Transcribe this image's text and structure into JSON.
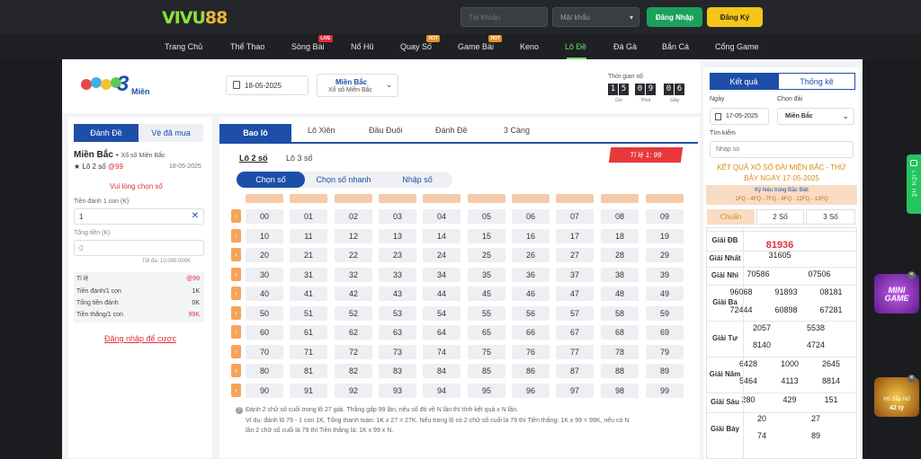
{
  "header": {
    "logo_a": "VIVU",
    "logo_b": "88",
    "username_placeholder": "Tài khoản",
    "password_placeholder": "Mật khẩu",
    "login_label": "Đăng Nhập",
    "register_label": "Đăng Ký",
    "colors": {
      "login": "#1aa15a",
      "register": "#f5c518"
    }
  },
  "nav": {
    "items": [
      {
        "label": "Trang Chủ"
      },
      {
        "label": "Thể Thao"
      },
      {
        "label": "Sòng Bài",
        "badge": "LIVE"
      },
      {
        "label": "Nổ Hũ"
      },
      {
        "label": "Quay Số",
        "badge": "HOT"
      },
      {
        "label": "Game Bài",
        "badge": "HOT"
      },
      {
        "label": "Keno"
      },
      {
        "label": "Lô Đề"
      },
      {
        "label": "Đá Gà"
      },
      {
        "label": "Bắn Cá"
      },
      {
        "label": "Cổng Game"
      }
    ]
  },
  "topbar": {
    "logo_text": "Miền",
    "logo_number": "3",
    "date": "18-05-2025",
    "region_title": "Miền Bắc",
    "region_sub": "Xổ số Miền Bắc",
    "time_label": "Thời gian xổ",
    "digits": [
      "1",
      "5",
      "0",
      "9",
      "0",
      "6"
    ],
    "units": [
      "Giờ",
      "Phút",
      "Giây"
    ]
  },
  "left": {
    "tabs": [
      "Đánh Đề",
      "Vé đã mua"
    ],
    "region": "Miền Bắc -",
    "region_sub": "Xổ số Miền Bắc",
    "bet_type": "★ Lô 2 số",
    "bet_rate": "@99",
    "date": "18-05-2025",
    "choose_prompt": "Vui lòng chọn số",
    "per_unit_label": "Tiền đánh 1 con (K)",
    "per_unit_value": "1",
    "total_label": "Tổng tiền (K)",
    "total_placeholder": "0",
    "max_text": "Tối đa: 10.000.000K",
    "rows": [
      {
        "label": "Tỉ lệ",
        "value": "@99"
      },
      {
        "label": "Tiền đánh/1 con",
        "value": "1K"
      },
      {
        "label": "Tổng tiền đánh",
        "value": "0K"
      },
      {
        "label": "Tiền thắng/1 con",
        "value": "99K"
      }
    ],
    "login_link": "Đăng nhập để cược"
  },
  "center": {
    "tabs": [
      "Bao lô",
      "Lô Xiên",
      "Đầu Đuôi",
      "Đánh Đề",
      "3 Càng"
    ],
    "subtabs": [
      "Lô 2 số",
      "Lô 3 số"
    ],
    "rate": "Tỉ lệ 1: 99",
    "pills": [
      "Chọn số",
      "Chọn số nhanh",
      "Nhập số"
    ],
    "numbers": [
      [
        "00",
        "01",
        "02",
        "03",
        "04",
        "05",
        "06",
        "07",
        "08",
        "09"
      ],
      [
        "10",
        "11",
        "12",
        "13",
        "14",
        "15",
        "16",
        "17",
        "18",
        "19"
      ],
      [
        "20",
        "21",
        "22",
        "23",
        "24",
        "25",
        "26",
        "27",
        "28",
        "29"
      ],
      [
        "30",
        "31",
        "32",
        "33",
        "34",
        "35",
        "36",
        "37",
        "38",
        "39"
      ],
      [
        "40",
        "41",
        "42",
        "43",
        "44",
        "45",
        "46",
        "47",
        "48",
        "49"
      ],
      [
        "50",
        "51",
        "52",
        "53",
        "54",
        "55",
        "56",
        "57",
        "58",
        "59"
      ],
      [
        "60",
        "61",
        "62",
        "63",
        "64",
        "65",
        "66",
        "67",
        "68",
        "69"
      ],
      [
        "70",
        "71",
        "72",
        "73",
        "74",
        "75",
        "76",
        "77",
        "78",
        "79"
      ],
      [
        "80",
        "81",
        "82",
        "83",
        "84",
        "85",
        "86",
        "87",
        "88",
        "89"
      ],
      [
        "90",
        "91",
        "92",
        "93",
        "94",
        "95",
        "96",
        "97",
        "98",
        "99"
      ]
    ],
    "chev_glyph": "›",
    "notes": [
      "Đánh 2 chữ số cuối trong lô 27 giải. Thắng gấp 99 lần, nếu số đó về N lần thì tính kết quả x N lần.",
      "Ví dụ: đánh lô 79 - 1 con 1K, Tổng thanh toán: 1K x 27 = 27K. Nếu trong lô có 2 chữ số cuối là 79 thì Tiền thắng: 1K x 99 = 99K, nếu có N",
      "lần 2 chữ số cuối là 79 thì Tiền thắng là: 1K x 99 x N."
    ]
  },
  "right": {
    "tabs": [
      "Kết quả",
      "Thống kê"
    ],
    "date_label": "Ngày",
    "region_label": "Chọn đài",
    "date": "17-05-2025",
    "region": "Miền Bắc",
    "search_label": "Tìm kiếm",
    "search_placeholder": "Nhập số",
    "title_1": "KẾT QUẢ XỔ SỐ ĐÀI MIỀN BẮC - THỨ",
    "title_2": "BẢY NGÀY 17-05-2025",
    "special_label": "Ký hiệu trúng Đặc Biệt",
    "special_codes": "1FQ - 4FQ - 7FQ - 9FQ - 12FQ - 13FQ",
    "view_tabs": [
      "Chuẩn",
      "2 Số",
      "3 Số"
    ],
    "prizes": [
      {
        "label": "Giải ĐB",
        "values": [
          "81936"
        ]
      },
      {
        "label": "Giải Nhất",
        "values": [
          "31605"
        ]
      },
      {
        "label": "Giải Nhì",
        "values": [
          "70586",
          "07506"
        ]
      },
      {
        "label": "Giải Ba",
        "values": [
          "96068",
          "91893",
          "08181",
          "72444",
          "60898",
          "67281"
        ]
      },
      {
        "label": "Giải Tư",
        "values": [
          "2057",
          "5538",
          "8140",
          "4724"
        ]
      },
      {
        "label": "Giải Năm",
        "values": [
          "6428",
          "1000",
          "2645",
          "5464",
          "4113",
          "8814"
        ]
      },
      {
        "label": "Giải Sáu",
        "values": [
          "280",
          "429",
          "151"
        ]
      },
      {
        "label": "Giải Bảy",
        "values": [
          "20",
          "27",
          "74",
          "89"
        ]
      }
    ]
  },
  "side": {
    "live_tab": "LIÊN HỆ",
    "promo1": "MINI GAME",
    "promo2_a": "Hũ Sắp Nổ",
    "promo2_b": "42 tỷ"
  }
}
